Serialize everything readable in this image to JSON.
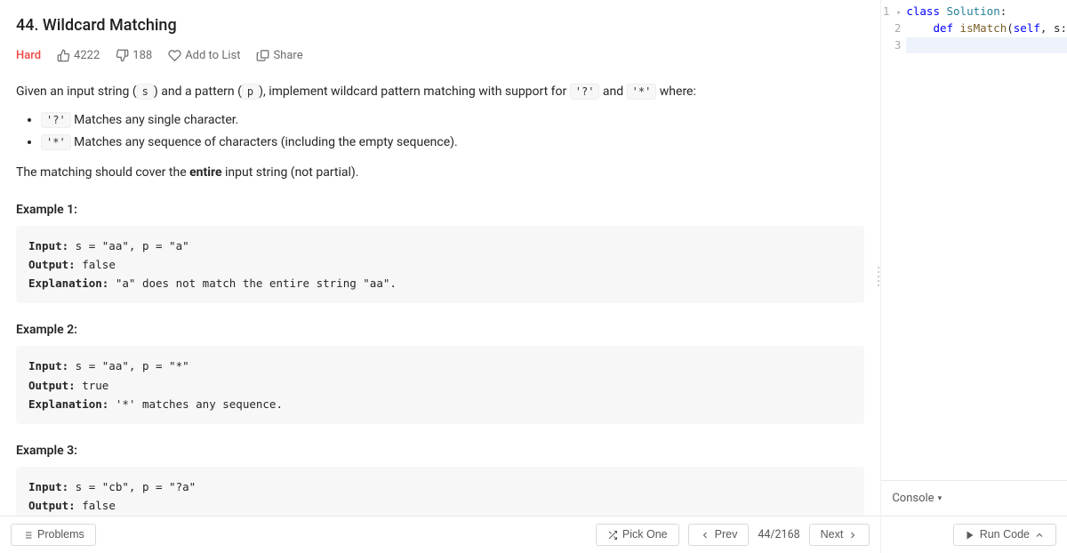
{
  "problem": {
    "title": "44. Wildcard Matching",
    "difficulty": "Hard",
    "likes": "4222",
    "dislikes": "188",
    "add_to_list": "Add to List",
    "share": "Share",
    "intro_before_s": "Given an input string (",
    "intro_s": "s",
    "intro_between": ") and a pattern (",
    "intro_p": "p",
    "intro_after_p": "), implement wildcard pattern matching with support for ",
    "intro_q": "'?'",
    "intro_and": " and ",
    "intro_star": "'*'",
    "intro_where": " where:",
    "bullet_q_code": "'?'",
    "bullet_q_text": " Matches any single character.",
    "bullet_star_code": "'*'",
    "bullet_star_text": " Matches any sequence of characters (including the empty sequence).",
    "cover_before_strong": "The matching should cover the ",
    "cover_strong": "entire",
    "cover_after_strong": " input string (not partial).",
    "example1_title": "Example 1:",
    "example1_body": "Input: s = \"aa\", p = \"a\"\nOutput: false\nExplanation: \"a\" does not match the entire string \"aa\".",
    "example2_title": "Example 2:",
    "example2_body": "Input: s = \"aa\", p = \"*\"\nOutput: true\nExplanation: '*' matches any sequence.",
    "example3_title": "Example 3:",
    "example3_body": "Input: s = \"cb\", p = \"?a\"\nOutput: false"
  },
  "bottom": {
    "problems": "Problems",
    "pick_one": "Pick One",
    "prev": "Prev",
    "counter": "44/2168",
    "next": "Next"
  },
  "code": {
    "line1_kw": "class",
    "line1_cls": " Solution",
    "line1_colon": ":",
    "line2_indent": "    ",
    "line2_kw": "def",
    "line2_fn": " isMatch",
    "line2_paren": "(",
    "line2_self": "self",
    "line2_rest": ", s:"
  },
  "gutter": {
    "l1": "1",
    "l2": "2",
    "l3": "3"
  },
  "console_label": "Console",
  "run_code": "Run Code"
}
